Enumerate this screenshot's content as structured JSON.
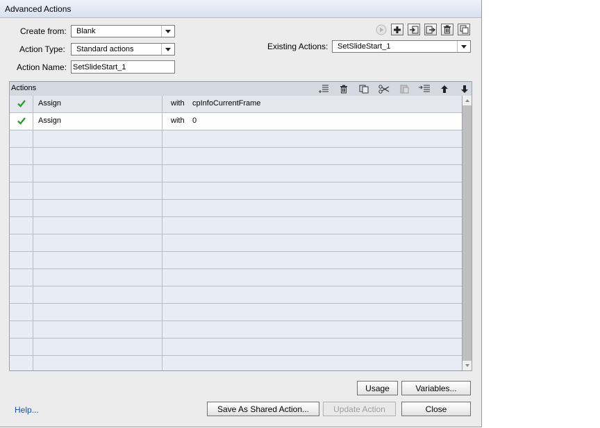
{
  "window": {
    "title": "Advanced Actions"
  },
  "form": {
    "create_from_label": "Create from:",
    "create_from_value": "Blank",
    "action_type_label": "Action Type:",
    "action_type_value": "Standard actions",
    "action_name_label": "Action Name:",
    "action_name_value": "SetSlideStart_1",
    "existing_actions_label": "Existing Actions:",
    "existing_actions_value": "SetSlideStart_1"
  },
  "toolbar_icons": [
    "preview-icon",
    "add-icon",
    "import-icon",
    "export-icon",
    "delete-icon",
    "duplicate-icon"
  ],
  "actions_panel": {
    "title": "Actions",
    "toolbar_icons": [
      "insert-row-icon",
      "delete-row-icon",
      "copy-row-icon",
      "cut-icon",
      "paste-icon",
      "indent-icon",
      "move-up-icon",
      "move-down-icon"
    ],
    "rows": [
      {
        "status": "check-icon",
        "command": "Assign",
        "keyword": "with",
        "value": "cpInfoCurrentFrame"
      },
      {
        "status": "check-icon",
        "command": "Assign",
        "keyword": "with",
        "value": "0"
      }
    ]
  },
  "buttons": {
    "usage": "Usage",
    "variables": "Variables...",
    "save_shared": "Save As Shared Action...",
    "update": "Update Action",
    "close": "Close"
  },
  "help_link": "Help...",
  "colors": {
    "check": "#2e9b2e",
    "link": "#1a4da8",
    "titlebar": "#d9e1ef",
    "panel": "#e8ecf4"
  }
}
